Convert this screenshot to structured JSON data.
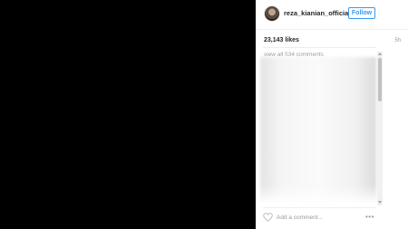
{
  "post": {
    "username": "reza_kianian_official",
    "follow_label": "Follow",
    "likes": "23,143 likes",
    "time": "5h",
    "view_all_comments": "view all 534 comments",
    "add_comment_placeholder": "Add a comment...",
    "more_options": "•••"
  },
  "colors": {
    "accent": "#3897f0",
    "media_background": "#000000",
    "panel_background": "#ffffff"
  },
  "icons": {
    "avatar": "profile-avatar",
    "like": "heart-icon",
    "options": "more-options-icon"
  }
}
